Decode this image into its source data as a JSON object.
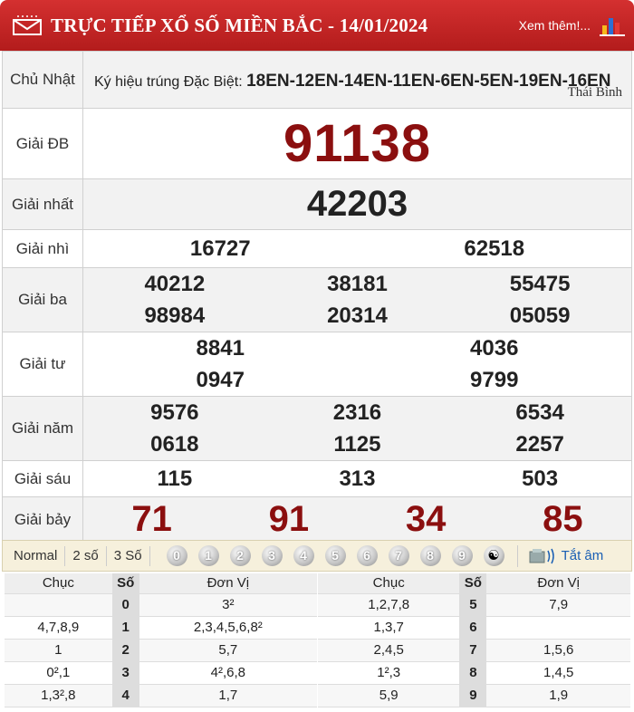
{
  "header": {
    "title": "TRỰC TIẾP XỔ SỐ MIỀN BẮC - 14/01/2024",
    "more": "Xem thêm!...",
    "icons": {
      "mail": "mail-icon",
      "chart": "bar-chart-icon"
    },
    "color": "#c62828"
  },
  "special_code": {
    "day": "Chủ Nhật",
    "label": "Ký hiệu trúng Đặc Biệt:",
    "code": "18EN-12EN-14EN-11EN-6EN-5EN-19EN-16EN",
    "province": "Thái Bình"
  },
  "prizes": {
    "db": {
      "label": "Giải ĐB",
      "numbers": [
        "91138"
      ]
    },
    "nhat": {
      "label": "Giải nhất",
      "numbers": [
        "42203"
      ]
    },
    "nhi": {
      "label": "Giải nhì",
      "numbers": [
        "16727",
        "62518"
      ]
    },
    "ba": {
      "label": "Giải ba",
      "numbers": [
        "40212",
        "38181",
        "55475",
        "98984",
        "20314",
        "05059"
      ]
    },
    "tu": {
      "label": "Giải tư",
      "numbers": [
        "8841",
        "4036",
        "0947",
        "9799"
      ]
    },
    "nam": {
      "label": "Giải năm",
      "numbers": [
        "9576",
        "2316",
        "6534",
        "0618",
        "1125",
        "2257"
      ]
    },
    "sau": {
      "label": "Giải sáu",
      "numbers": [
        "115",
        "313",
        "503"
      ]
    },
    "bay": {
      "label": "Giải bảy",
      "numbers": [
        "71",
        "91",
        "34",
        "85"
      ]
    }
  },
  "toolbar": {
    "modes": [
      "Normal",
      "2 số",
      "3 Số"
    ],
    "balls": [
      "0",
      "1",
      "2",
      "3",
      "4",
      "5",
      "6",
      "7",
      "8",
      "9",
      "☯"
    ],
    "audio_label": "Tắt âm"
  },
  "loto": {
    "headers": [
      "Chục",
      "Số",
      "Đơn Vị"
    ],
    "left": [
      {
        "chuc": "",
        "so": "0",
        "donvi": "3²"
      },
      {
        "chuc": "4,7,8,9",
        "so": "1",
        "donvi": "2,3,4,5,6,8²"
      },
      {
        "chuc": "1",
        "so": "2",
        "donvi": "5,7"
      },
      {
        "chuc": "0²,1",
        "so": "3",
        "donvi": "4²,6,8"
      },
      {
        "chuc": "1,3²,8",
        "so": "4",
        "donvi": "1,7"
      }
    ],
    "right": [
      {
        "chuc": "1,2,7,8",
        "so": "5",
        "donvi": "7,9"
      },
      {
        "chuc": "1,3,7",
        "so": "6",
        "donvi": ""
      },
      {
        "chuc": "2,4,5",
        "so": "7",
        "donvi": "1,5,6"
      },
      {
        "chuc": "1²,3",
        "so": "8",
        "donvi": "1,4,5"
      },
      {
        "chuc": "5,9",
        "so": "9",
        "donvi": "1,9"
      }
    ]
  }
}
